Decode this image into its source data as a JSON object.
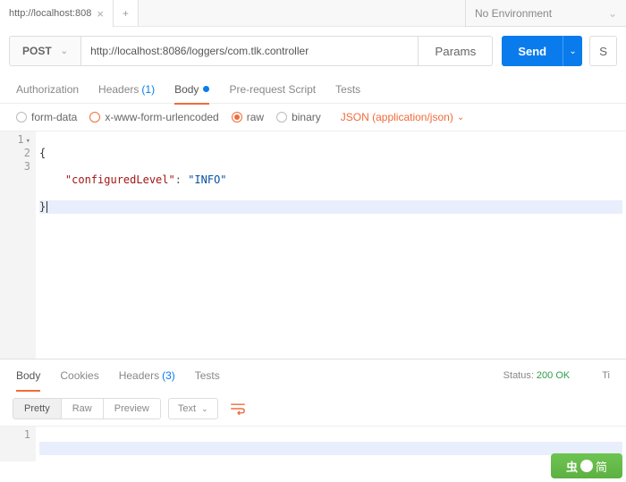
{
  "tabs": {
    "items": [
      {
        "title": "http://localhost:808"
      }
    ],
    "add": "+"
  },
  "environment": {
    "label": "No Environment"
  },
  "request": {
    "method": "POST",
    "url": "http://localhost:8086/loggers/com.tlk.controller",
    "params_label": "Params",
    "send_label": "Send",
    "save_label": "S"
  },
  "request_tabs": {
    "authorization": "Authorization",
    "headers": "Headers",
    "headers_count": "(1)",
    "body": "Body",
    "prerequest": "Pre-request Script",
    "tests": "Tests"
  },
  "body_types": {
    "form_data": "form-data",
    "urlencoded": "x-www-form-urlencoded",
    "raw": "raw",
    "binary": "binary",
    "content_type": "JSON (application/json)"
  },
  "editor": {
    "lines": [
      "1",
      "2",
      "3"
    ],
    "line1": "{",
    "indent": "    ",
    "key": "\"configuredLevel\"",
    "colon": ": ",
    "value": "\"INFO\"",
    "line3": "}"
  },
  "chart_data": {
    "type": "table",
    "title": "Request Body JSON",
    "payload": {
      "configuredLevel": "INFO"
    }
  },
  "response_tabs": {
    "body": "Body",
    "cookies": "Cookies",
    "headers": "Headers",
    "headers_count": "(3)",
    "tests": "Tests",
    "status_label": "Status:",
    "status_value": "200 OK",
    "time_label": "Ti"
  },
  "response_toolbar": {
    "pretty": "Pretty",
    "raw": "Raw",
    "preview": "Preview",
    "format": "Text"
  },
  "response_editor": {
    "line1_num": "1",
    "line1": ""
  },
  "watermark": {
    "text": "简"
  }
}
